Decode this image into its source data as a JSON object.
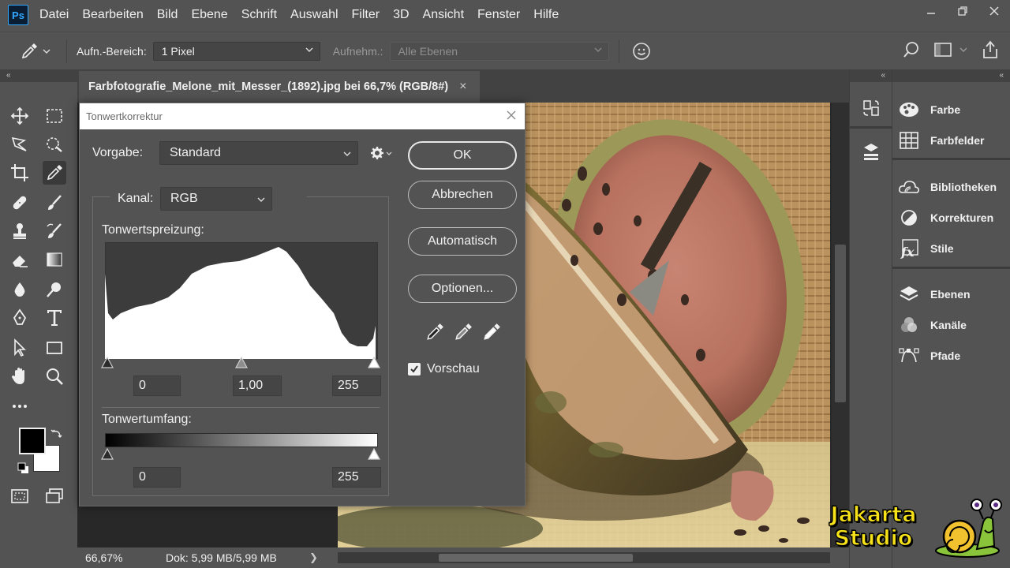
{
  "app": {
    "logo": "Ps",
    "menu": [
      "Datei",
      "Bearbeiten",
      "Bild",
      "Ebene",
      "Schrift",
      "Auswahl",
      "Filter",
      "3D",
      "Ansicht",
      "Fenster",
      "Hilfe"
    ]
  },
  "options": {
    "sample_label": "Aufn.-Bereich:",
    "sample_value": "1 Pixel",
    "sample_from_label": "Aufnehm.:",
    "sample_from_value": "Alle Ebenen"
  },
  "document": {
    "tab_title": "Farbfotografie_Melone_mit_Messer_(1892).jpg bei 66,7% (RGB/8#)",
    "close": "×"
  },
  "status": {
    "zoom": "66,67%",
    "doc_info": "Dok: 5,99 MB/5,99 MB",
    "arrow": "❯"
  },
  "collapse": {
    "left": "«",
    "right": "«"
  },
  "panels": [
    {
      "label": "Farbe",
      "icon": "palette-icon"
    },
    {
      "label": "Farbfelder",
      "icon": "swatches-icon"
    },
    {
      "label": "Bibliotheken",
      "icon": "libraries-icon"
    },
    {
      "label": "Korrekturen",
      "icon": "adjustments-icon"
    },
    {
      "label": "Stile",
      "icon": "styles-icon"
    },
    {
      "label": "Ebenen",
      "icon": "layers-icon"
    },
    {
      "label": "Kanäle",
      "icon": "channels-icon"
    },
    {
      "label": "Pfade",
      "icon": "paths-icon"
    }
  ],
  "dialog": {
    "title": "Tonwertkorrektur",
    "preset_label": "Vorgabe:",
    "preset_value": "Standard",
    "channel_label": "Kanal:",
    "channel_value": "RGB",
    "input_levels_label": "Tonwertspreizung:",
    "input_black": "0",
    "input_gamma": "1,00",
    "input_white": "255",
    "output_levels_label": "Tonwertumfang:",
    "output_black": "0",
    "output_white": "255",
    "buttons": {
      "ok": "OK",
      "cancel": "Abbrechen",
      "auto": "Automatisch",
      "options": "Optionen..."
    },
    "preview_label": "Vorschau",
    "preview_checked": true
  },
  "watermark": {
    "line1": "Jakarta",
    "line2": "Studio"
  }
}
